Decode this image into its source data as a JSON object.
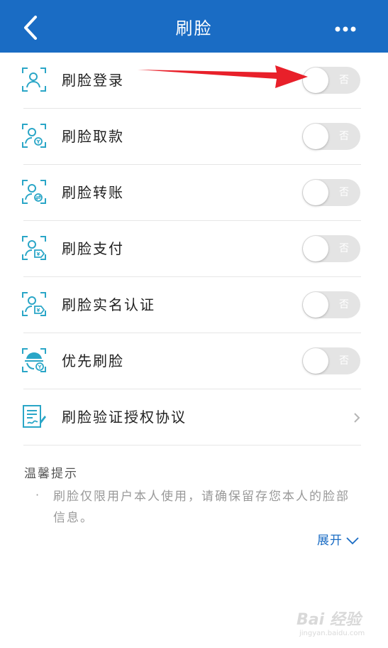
{
  "header": {
    "title": "刷脸"
  },
  "settings": [
    {
      "label": "刷脸登录",
      "state": "否"
    },
    {
      "label": "刷脸取款",
      "state": "否"
    },
    {
      "label": "刷脸转账",
      "state": "否"
    },
    {
      "label": "刷脸支付",
      "state": "否"
    },
    {
      "label": "刷脸实名认证",
      "state": "否"
    },
    {
      "label": "优先刷脸",
      "state": "否"
    }
  ],
  "agreement": {
    "label": "刷脸验证授权协议"
  },
  "tips": {
    "title": "温馨提示",
    "bullet": "·",
    "text": "刷脸仅限用户本人使用，请确保留存您本人的脸部信息。",
    "expand_label": "展开"
  },
  "watermark": {
    "top": "Bai 经验",
    "bottom": "jingyan.baidu.com"
  },
  "colors": {
    "header_bg": "#1a6cc4",
    "icon": "#2aa6c7",
    "arrow": "#e8202a",
    "toggle_off": "#e4e4e4"
  },
  "icons": {
    "back": "chevron-left-icon",
    "more": "more-dots-icon",
    "rows": [
      "face-login-icon",
      "face-withdraw-icon",
      "face-transfer-icon",
      "face-pay-icon",
      "face-realname-icon",
      "face-priority-icon"
    ],
    "agreement": "document-sign-icon"
  }
}
